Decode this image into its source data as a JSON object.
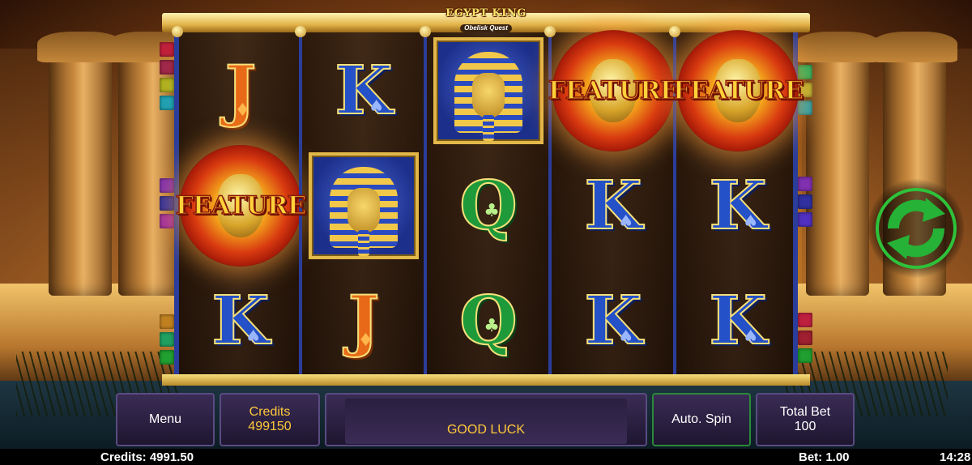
{
  "game": {
    "logo_title": "EGYPT KING",
    "logo_subtitle": "Obelisk Quest"
  },
  "reels": [
    [
      {
        "type": "letter",
        "letter": "J",
        "suit": "♦"
      },
      {
        "type": "feature",
        "label": "FEATURE"
      },
      {
        "type": "letter",
        "letter": "K",
        "suit": "♠"
      }
    ],
    [
      {
        "type": "letter",
        "letter": "K",
        "suit": "♠"
      },
      {
        "type": "pharaoh"
      },
      {
        "type": "letter",
        "letter": "J",
        "suit": "♦"
      }
    ],
    [
      {
        "type": "pharaoh"
      },
      {
        "type": "letter",
        "letter": "Q",
        "suit": "♣"
      },
      {
        "type": "letter",
        "letter": "Q",
        "suit": "♣"
      }
    ],
    [
      {
        "type": "feature",
        "label": "FEATURE"
      },
      {
        "type": "letter",
        "letter": "K",
        "suit": "♠"
      },
      {
        "type": "letter",
        "letter": "K",
        "suit": "♠"
      }
    ],
    [
      {
        "type": "feature",
        "label": "FEATURE"
      },
      {
        "type": "letter",
        "letter": "K",
        "suit": "♠"
      },
      {
        "type": "letter",
        "letter": "K",
        "suit": "♠"
      }
    ]
  ],
  "controls": {
    "menu_label": "Menu",
    "credits_label": "Credits",
    "credits_value": "499150",
    "message": "GOOD LUCK",
    "autospin_label": "Auto. Spin",
    "total_bet_label": "Total Bet",
    "total_bet_value": "100",
    "spin_icon": "refresh-arrows-icon"
  },
  "status": {
    "credits": "Credits: 4991.50",
    "bet": "Bet: 1.00",
    "clock": "14:28"
  },
  "colors": {
    "spin_green": "#2ec23a",
    "gold_text": "#ffc83a",
    "reel_divider": "#2a3d9a",
    "panel_bg": "#2c2244"
  }
}
